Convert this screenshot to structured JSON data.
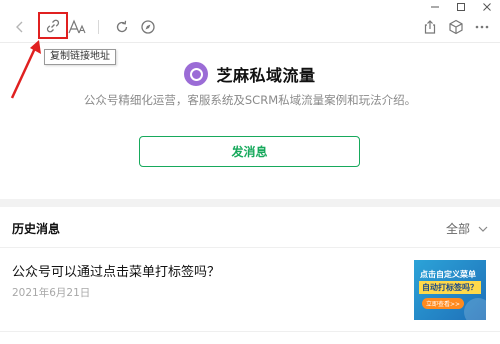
{
  "toolbar": {
    "back_icon": "chevron-left-icon",
    "link_icon": "link-icon",
    "font_icon": "font-size-icon",
    "refresh_icon": "refresh-icon",
    "compass_icon": "compass-icon",
    "share_icon": "share-icon",
    "cube_icon": "cube-icon",
    "more_icon": "more-icon",
    "highlight_color": "#e02020"
  },
  "tooltip": {
    "text": "复制链接地址"
  },
  "account": {
    "name": "芝麻私域流量",
    "description": "公众号精细化运营，客服系统及SCRM私域流量案例和玩法介绍。",
    "avatar_color": "#9b6cd6"
  },
  "actions": {
    "send_message_label": "发消息",
    "accent_color": "#17a95c"
  },
  "history": {
    "title": "历史消息",
    "filter_label": "全部",
    "articles": [
      {
        "title": "公众号可以通过点击菜单打标签吗？",
        "date": "2021年6月21日",
        "thumb_line1": "点击自定义菜单",
        "thumb_line2": "自动打标签吗？",
        "thumb_button": "立即查看>>"
      }
    ]
  }
}
